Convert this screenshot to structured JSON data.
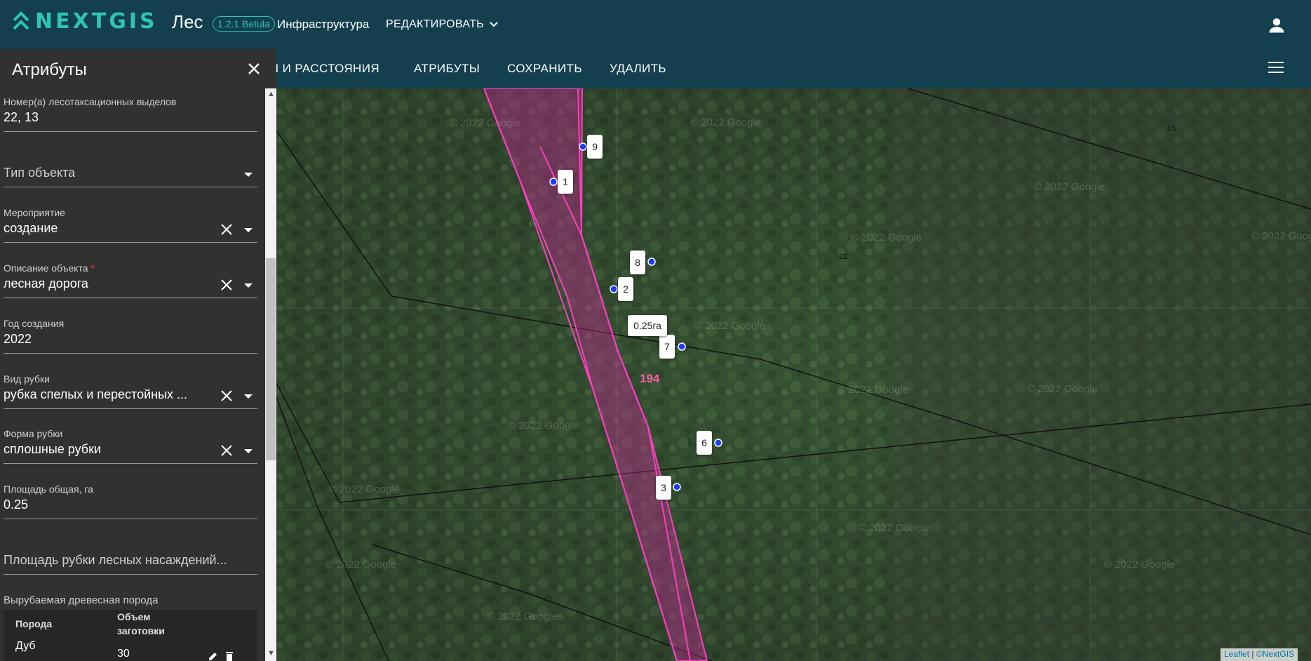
{
  "header": {
    "brand": "NEXTGIS",
    "app_name": "Лес",
    "version": "1.2.1 Betula",
    "section": "Инфраструктура",
    "edit_menu": "РЕДАКТИРОВАТЬ",
    "brand_color": "#2ec4b6",
    "bar_color": "#133f4e"
  },
  "toolbar": {
    "measure": "Ы И РАССТОЯНИЯ",
    "attributes": "АТРИБУТЫ",
    "save": "СОХРАНИТЬ",
    "delete": "УДАЛИТЬ"
  },
  "panel": {
    "title": "Атрибуты",
    "fields": {
      "plot_numbers": {
        "label": "Номер(а) лесотаксационных выделов",
        "value": "22, 13"
      },
      "object_type": {
        "placeholder": "Тип объекта"
      },
      "event": {
        "label": "Мероприятие",
        "value": "создание"
      },
      "description": {
        "label": "Описание объекта",
        "required_mark": "*",
        "value": "лесная дорога"
      },
      "year": {
        "label": "Год создания",
        "value": "2022"
      },
      "cut_kind": {
        "label": "Вид рубки",
        "value": "рубка спелых и перестойных ..."
      },
      "cut_form": {
        "label": "Форма рубки",
        "value": "сплошные рубки"
      },
      "area_total": {
        "label": "Площадь общая, га",
        "value": "0.25"
      },
      "area_cut": {
        "placeholder": "Площадь рубки лесных насаждений..."
      }
    },
    "species_table": {
      "title": "Вырубаемая древесная порода",
      "col_species": "Порода",
      "col_volume": "Объем заготовки",
      "rows": [
        {
          "species": "Дуб",
          "volume": "30"
        }
      ]
    }
  },
  "map": {
    "area_label": "0.25га",
    "plot_number": "194",
    "plot_22": "22",
    "plot_15": "15",
    "plot_1": "1",
    "vertices": [
      "9",
      "1",
      "8",
      "2",
      "7",
      "6",
      "3"
    ],
    "watermark": "© 2022 Google",
    "attribution_leaflet": "Leaflet",
    "attribution_sep": "|",
    "attribution_nextgis": "©NextGIS",
    "polygon_color": "#ff3fc0",
    "vertex_color": "#1a3cff"
  }
}
